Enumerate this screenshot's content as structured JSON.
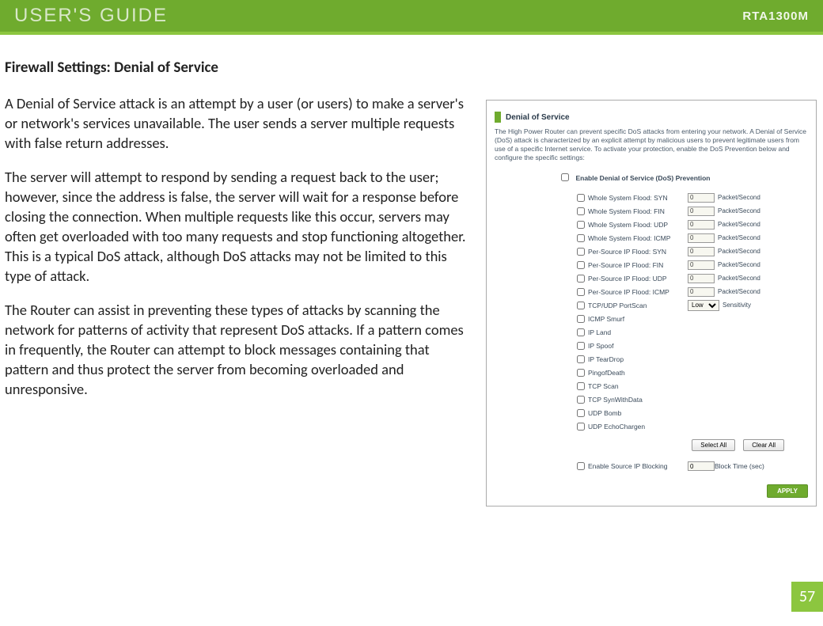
{
  "header": {
    "title": "USER'S GUIDE",
    "model": "RTA1300M"
  },
  "section_title": "Firewall Settings: Denial of Service",
  "paragraphs": [
    "A Denial of Service attack is an attempt by a user (or users) to make a server's or network's services unavailable. The user sends a server multiple requests with false return addresses.",
    "The server will attempt to respond by sending a request back to the user; however, since the address is false, the server will wait for a response before closing the connection. When multiple requests like this occur, servers may often get overloaded with too many requests and stop functioning altogether. This is a typical DoS attack, although DoS attacks may not be limited to this type of attack.",
    "The Router can assist in preventing these types of attacks by scanning the network for patterns of activity that represent DoS attacks. If a pattern comes in frequently, the Router can attempt to block messages containing that pattern and thus protect the server from becoming overloaded and unresponsive."
  ],
  "panel": {
    "title": "Denial of Service",
    "description": "The High Power Router can prevent specific DoS attacks from entering your network. A Denial of Service (DoS) attack is characterized by an explicit attempt by malicious users to prevent legitimate users from use of a specific Internet service. To activate your protection, enable the DoS Prevention below and configure the specific settings:",
    "enable_label": "Enable Denial of Service (DoS) Prevention",
    "rate_options": [
      {
        "label": "Whole System Flood: SYN",
        "value": "0",
        "unit": "Packet/Second"
      },
      {
        "label": "Whole System Flood: FIN",
        "value": "0",
        "unit": "Packet/Second"
      },
      {
        "label": "Whole System Flood: UDP",
        "value": "0",
        "unit": "Packet/Second"
      },
      {
        "label": "Whole System Flood: ICMP",
        "value": "0",
        "unit": "Packet/Second"
      },
      {
        "label": "Per-Source IP Flood: SYN",
        "value": "0",
        "unit": "Packet/Second"
      },
      {
        "label": "Per-Source IP Flood: FIN",
        "value": "0",
        "unit": "Packet/Second"
      },
      {
        "label": "Per-Source IP Flood: UDP",
        "value": "0",
        "unit": "Packet/Second"
      },
      {
        "label": "Per-Source IP Flood: ICMP",
        "value": "0",
        "unit": "Packet/Second"
      }
    ],
    "portscan": {
      "label": "TCP/UDP PortScan",
      "value": "Low",
      "unit": "Sensitivity"
    },
    "bool_options": [
      "ICMP Smurf",
      "IP Land",
      "IP Spoof",
      "IP TearDrop",
      "PingofDeath",
      "TCP Scan",
      "TCP SynWithData",
      "UDP Bomb",
      "UDP EchoChargen"
    ],
    "select_all": "Select All",
    "clear_all": "Clear All",
    "block": {
      "label": "Enable Source IP Blocking",
      "value": "0",
      "unit": "Block Time (sec)"
    },
    "apply": "APPLY"
  },
  "page_number": "57"
}
